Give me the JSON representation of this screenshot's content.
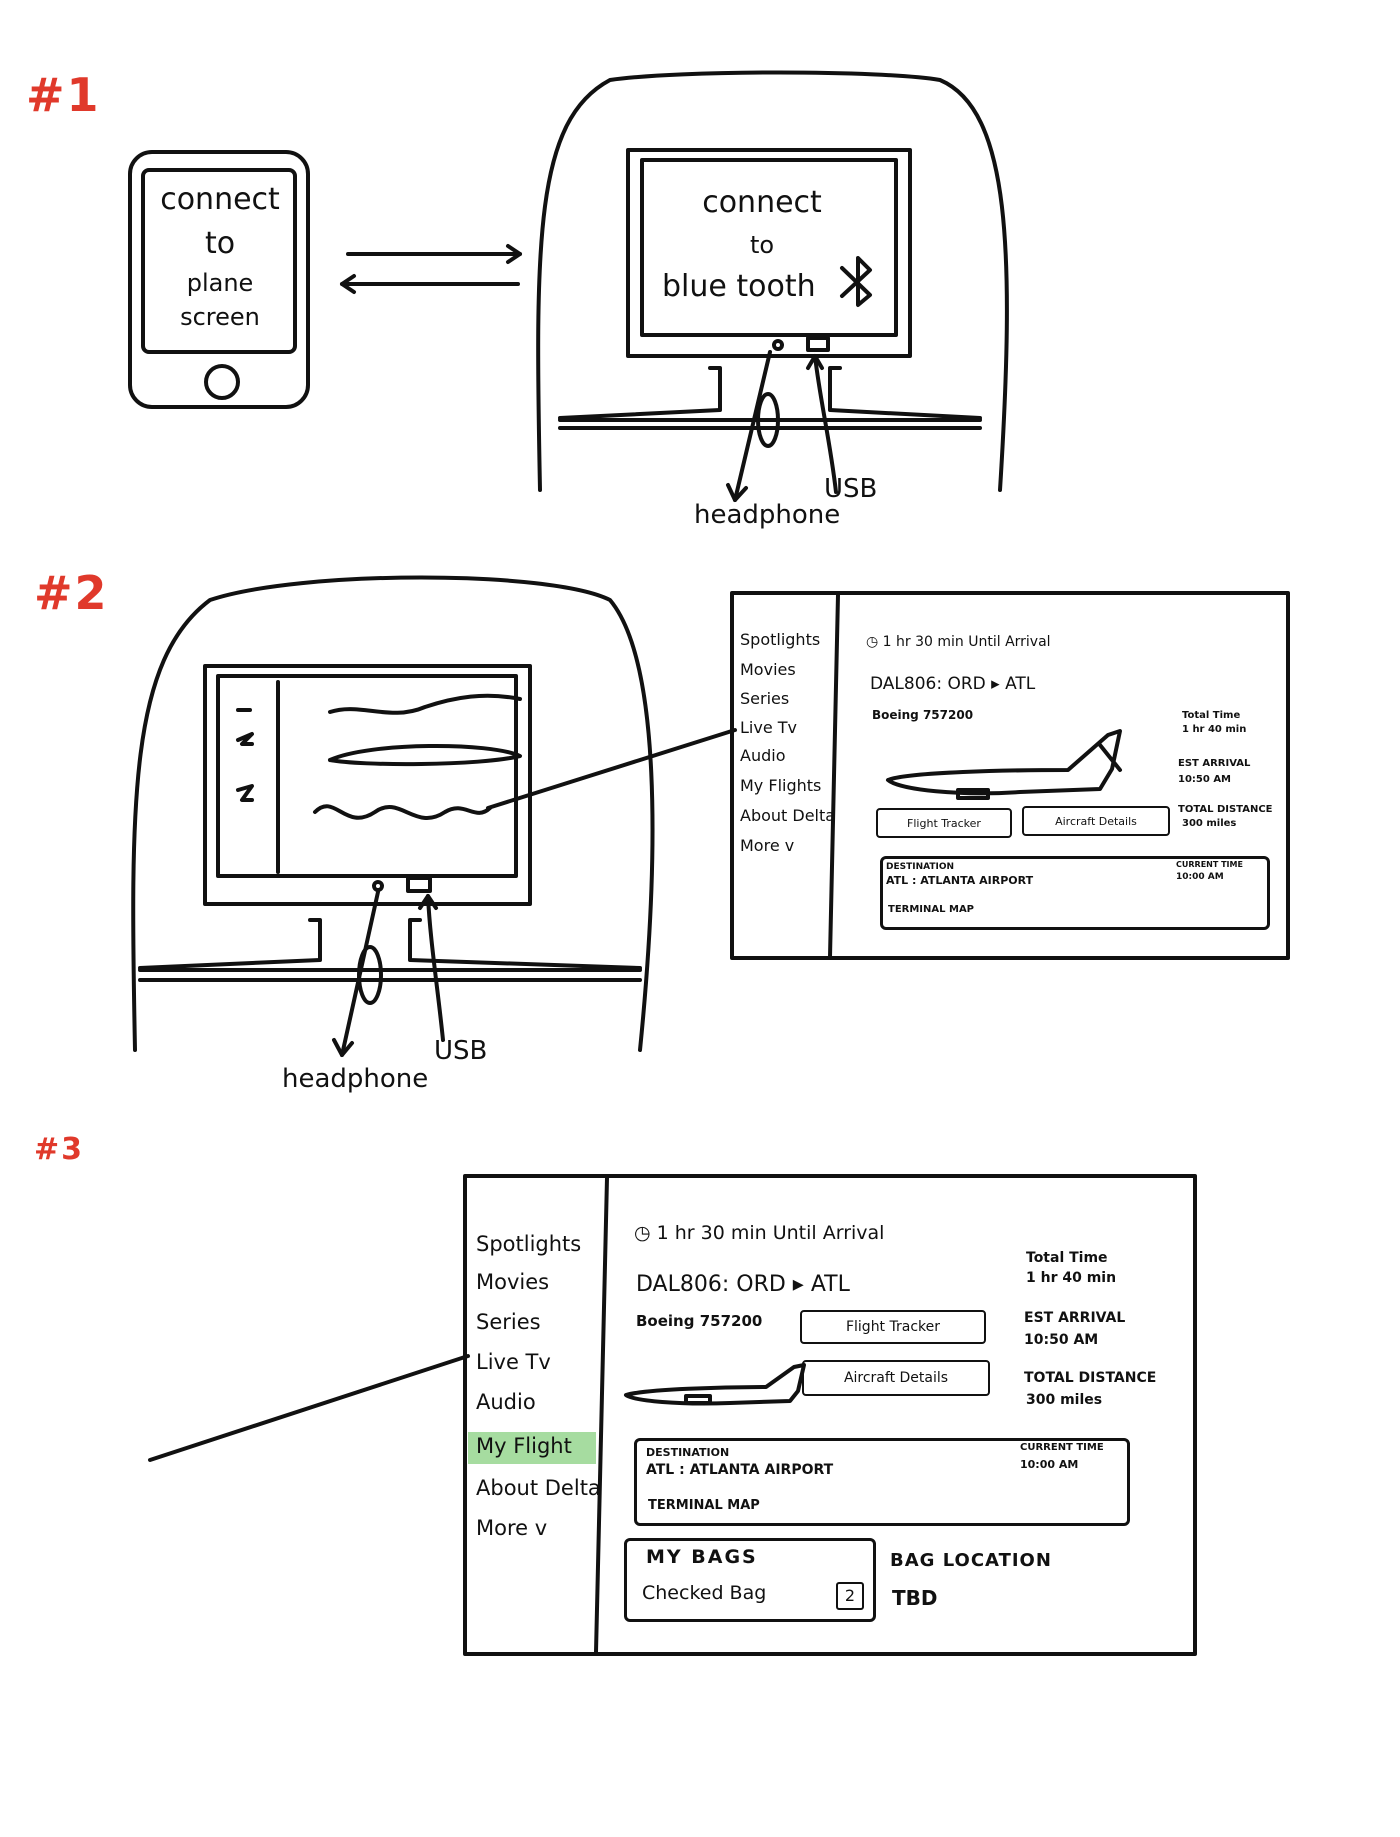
{
  "labels": {
    "s1": "#1",
    "s2": "#2",
    "s3": "#3"
  },
  "colors": {
    "label_red": "#e0392b",
    "ink": "#111111",
    "highlight_green": "#a6dca0"
  },
  "phone": {
    "lines": [
      "connect",
      "to",
      "plane",
      "screen"
    ]
  },
  "seatback1": {
    "lines": [
      "connect",
      "to",
      "blue tooth"
    ],
    "icon": "bluetooth-icon"
  },
  "callouts": {
    "headphone": "headphone",
    "usb": "USB"
  },
  "menu": {
    "items": [
      "Spotlights",
      "Movies",
      "Series",
      "Live Tv",
      "Audio",
      "My Flights",
      "About Delta",
      "More v"
    ]
  },
  "menu3": {
    "items": [
      "Spotlights",
      "Movies",
      "Series",
      "Live Tv",
      "Audio",
      "My Flight",
      "About Delta",
      "More v"
    ],
    "selected": "My Flight"
  },
  "flight": {
    "until": "1 hr 30 min   Until   Arrival",
    "flight_no": "DAL806: ORD ▸ ATL",
    "aircraft": "Boeing 757200",
    "total_time_label": "Total Time",
    "total_time_value": "1 hr 40 min",
    "est_arrival_label": "EST ARRIVAL",
    "est_arrival_value": "10:50 AM",
    "total_distance_label": "TOTAL DISTANCE",
    "total_distance_value": "300 miles",
    "flight_tracker": "Flight Tracker",
    "aircraft_details": "Aircraft Details",
    "destination_label": "DESTINATION",
    "destination_value": "ATL : ATLANTA AIRPORT",
    "terminal_map": "TERMINAL MAP",
    "current_time_label": "CURRENT TIME",
    "current_time_value": "10:00 AM"
  },
  "bags": {
    "title": "MY BAGS",
    "checked_label": "Checked Bag",
    "checked_count": "2",
    "location_label": "BAG LOCATION",
    "location_value": "TBD"
  }
}
